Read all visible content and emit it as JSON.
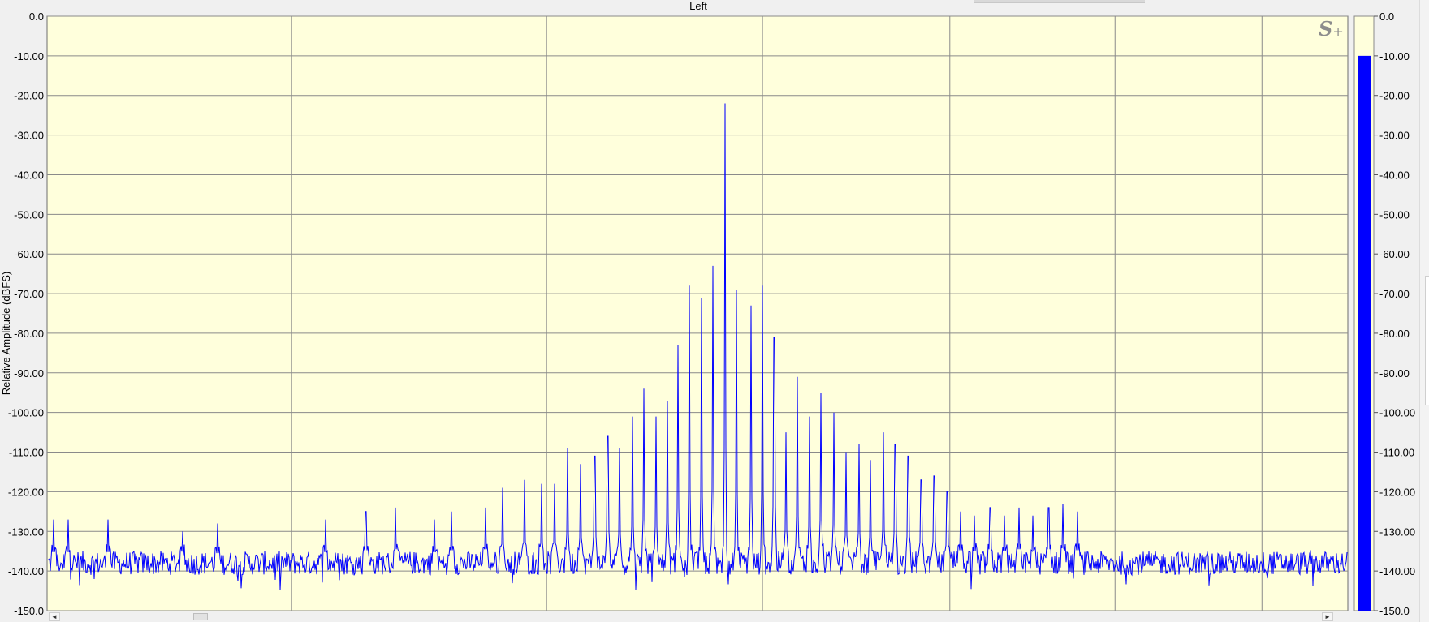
{
  "window": {
    "channel_title": "Left",
    "y_axis_label": "Relative Amplitude (dBFS)",
    "logo": {
      "letter": "S",
      "suffix": "+"
    }
  },
  "colors": {
    "plot_background": "#ffffdc",
    "grid": "#8a8a8a",
    "trace": "#0000ff",
    "meter_bar": "#0000ff"
  },
  "scrollbar": {
    "left_arrow": "◄",
    "right_arrow": "►"
  },
  "level_meter": {
    "value_db": -10.0,
    "range_db": [
      -150,
      0
    ],
    "tick_labels": [
      "0.0",
      "-10.00",
      "-20.00",
      "-30.00",
      "-40.00",
      "-50.00",
      "-60.00",
      "-70.00",
      "-80.00",
      "-90.00",
      "-100.00",
      "-110.00",
      "-120.00",
      "-130.00",
      "-140.00",
      "-150.0"
    ]
  },
  "chart_data": {
    "type": "line",
    "title": "Left",
    "xlabel": "",
    "ylabel": "Relative Amplitude (dBFS)",
    "ylim": [
      -150,
      0
    ],
    "xlim": [
      0,
      1
    ],
    "grid": true,
    "y_tick_values": [
      0,
      -10,
      -20,
      -30,
      -40,
      -50,
      -60,
      -70,
      -80,
      -90,
      -100,
      -110,
      -120,
      -130,
      -140,
      -150
    ],
    "y_tick_labels": [
      "0.0",
      "-10.00",
      "-20.00",
      "-30.00",
      "-40.00",
      "-50.00",
      "-60.00",
      "-70.00",
      "-80.00",
      "-90.00",
      "-100.00",
      "-110.00",
      "-120.00",
      "-130.00",
      "-140.00",
      "-150.0"
    ],
    "vertical_grid_x": [
      0.188,
      0.384,
      0.55,
      0.694,
      0.821,
      0.934
    ],
    "noise_floor_db": -138,
    "series": [
      {
        "color": "#0000ff",
        "x": [
          0.005,
          0.016,
          0.047,
          0.104,
          0.131,
          0.214,
          0.245,
          0.268,
          0.298,
          0.311,
          0.337,
          0.35,
          0.367,
          0.38,
          0.39,
          0.4,
          0.41,
          0.421,
          0.431,
          0.44,
          0.45,
          0.459,
          0.468,
          0.477,
          0.485,
          0.494,
          0.503,
          0.512,
          0.521,
          0.53,
          0.541,
          0.55,
          0.559,
          0.568,
          0.577,
          0.586,
          0.595,
          0.605,
          0.614,
          0.624,
          0.633,
          0.643,
          0.652,
          0.662,
          0.672,
          0.682,
          0.692,
          0.702,
          0.713,
          0.725,
          0.736,
          0.747,
          0.758,
          0.77,
          0.781,
          0.792
        ],
        "y": [
          -127,
          -127,
          -127,
          -130,
          -128,
          -127,
          -125,
          -124,
          -127,
          -125,
          -124,
          -119,
          -117,
          -118,
          -118,
          -109,
          -113,
          -111,
          -106,
          -109,
          -101,
          -94,
          -101,
          -97,
          -83,
          -68,
          -71,
          -63,
          -22,
          -69,
          -73,
          -68,
          -81,
          -105,
          -91,
          -101,
          -95,
          -100,
          -110,
          -108,
          -112,
          -105,
          -108,
          -111,
          -117,
          -116,
          -120,
          -125,
          -126,
          -124,
          -126,
          -124,
          -126,
          -124,
          -123,
          -125
        ]
      }
    ]
  }
}
